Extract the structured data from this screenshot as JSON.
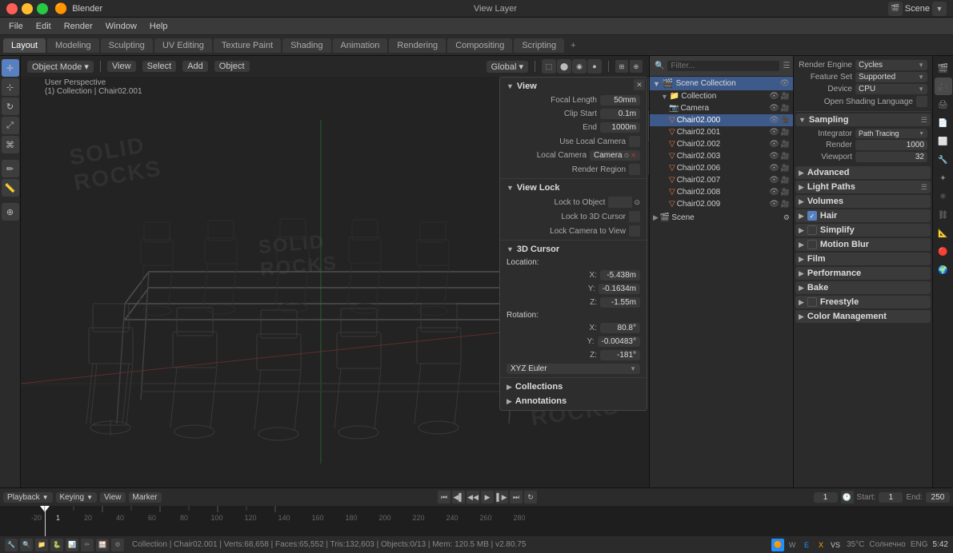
{
  "app": {
    "title": "Blender"
  },
  "titlebar": {
    "title": "Blender"
  },
  "menubar": {
    "items": [
      "File",
      "Edit",
      "Render",
      "Window",
      "Help"
    ]
  },
  "workspacetabs": {
    "tabs": [
      "Layout",
      "Modeling",
      "Sculpting",
      "UV Editing",
      "Texture Paint",
      "Shading",
      "Animation",
      "Rendering",
      "Compositing",
      "Scripting"
    ],
    "active": "Layout"
  },
  "viewport": {
    "mode": "Object Mode",
    "view": "User Perspective",
    "collection": "(1) Collection | Chair02.001",
    "global": "Global",
    "shading_mode": "Wireframe",
    "watermarks": [
      "SOLID",
      "ROCKS",
      "SOLID",
      "ROCKS",
      "SOLID",
      "ROCKS"
    ]
  },
  "view_panel": {
    "sections": {
      "view": {
        "title": "View",
        "focal_length": {
          "label": "Focal Length",
          "value": "50mm"
        },
        "clip_start": {
          "label": "Clip Start",
          "value": "0.1m"
        },
        "clip_end": {
          "label": "End",
          "value": "1000m"
        },
        "use_local_camera": {
          "label": "Use Local Camera",
          "checked": false
        },
        "local_camera": {
          "label": "Local Camera",
          "value": "Camera"
        },
        "render_region": {
          "label": "Render Region",
          "checked": false
        }
      },
      "view_lock": {
        "title": "View Lock",
        "lock_to_object": {
          "label": "Lock to Object",
          "value": ""
        },
        "lock_to_3d_cursor": {
          "label": "Lock to 3D Cursor",
          "checked": false
        },
        "lock_camera_to_view": {
          "label": "Lock Camera to View",
          "checked": false
        }
      },
      "cursor_3d": {
        "title": "3D Cursor",
        "location_label": "Location:",
        "x": {
          "label": "X:",
          "value": "-5.438m"
        },
        "y": {
          "label": "Y:",
          "value": "-0.1634m"
        },
        "z": {
          "label": "Z:",
          "value": "-1.55m"
        },
        "rotation_label": "Rotation:",
        "rx": {
          "label": "X:",
          "value": "80.8°"
        },
        "ry": {
          "label": "Y:",
          "value": "-0.00483°"
        },
        "rz": {
          "label": "Z:",
          "value": "-181°"
        },
        "rotation_mode": "XYZ Euler"
      },
      "collections": {
        "title": "Collections"
      },
      "annotations": {
        "title": "Annotations"
      }
    }
  },
  "outliner": {
    "title": "Scene Collection",
    "scene_label": "Scene",
    "items": [
      {
        "indent": 0,
        "icon": "📁",
        "label": "Collection",
        "has_arrow": true,
        "visible": true
      },
      {
        "indent": 1,
        "icon": "📷",
        "label": "Camera",
        "has_arrow": false,
        "visible": true
      },
      {
        "indent": 1,
        "icon": "🪑",
        "label": "Chair02.000",
        "has_arrow": false,
        "visible": true,
        "selected": true
      },
      {
        "indent": 1,
        "icon": "🪑",
        "label": "Chair02.001",
        "has_arrow": false,
        "visible": true
      },
      {
        "indent": 1,
        "icon": "🪑",
        "label": "Chair02.002",
        "has_arrow": false,
        "visible": true
      },
      {
        "indent": 1,
        "icon": "🪑",
        "label": "Chair02.003",
        "has_arrow": false,
        "visible": true
      },
      {
        "indent": 1,
        "icon": "🪑",
        "label": "Chair02.006",
        "has_arrow": false,
        "visible": true
      },
      {
        "indent": 1,
        "icon": "🪑",
        "label": "Chair02.007",
        "has_arrow": false,
        "visible": true
      },
      {
        "indent": 1,
        "icon": "🪑",
        "label": "Chair02.008",
        "has_arrow": false,
        "visible": true
      },
      {
        "indent": 1,
        "icon": "🪑",
        "label": "Chair02.009",
        "has_arrow": false,
        "visible": true
      }
    ]
  },
  "properties": {
    "active_tab": "render",
    "render_engine_label": "Render Engine",
    "render_engine_value": "Cycles",
    "feature_set_label": "Feature Set",
    "feature_set_value": "Supported",
    "device_label": "Device",
    "device_value": "CPU",
    "open_shading_label": "Open Shading Language",
    "sections": {
      "sampling": {
        "title": "Sampling",
        "integrator_label": "Integrator",
        "integrator_value": "Path Tracing",
        "render_label": "Render",
        "render_value": "1000",
        "viewport_label": "Viewport",
        "viewport_value": "32"
      },
      "advanced": {
        "title": "Advanced",
        "collapsed": true
      },
      "light_paths": {
        "title": "Light Paths",
        "collapsed": true
      },
      "volumes": {
        "title": "Volumes",
        "collapsed": true
      },
      "hair": {
        "title": "Hair",
        "checked": true,
        "collapsed": true
      },
      "simplify": {
        "title": "Simplify",
        "checked": false,
        "collapsed": true
      },
      "motion_blur": {
        "title": "Motion Blur",
        "checked": false,
        "collapsed": true
      },
      "film": {
        "title": "Film",
        "collapsed": true
      },
      "performance": {
        "title": "Performance",
        "collapsed": true
      },
      "bake": {
        "title": "Bake",
        "collapsed": true
      },
      "freestyle": {
        "title": "Freestyle",
        "checked": false,
        "collapsed": true
      },
      "color_management": {
        "title": "Color Management",
        "collapsed": true
      }
    }
  },
  "timeline": {
    "mode_label": "Playback",
    "keying_label": "Keying",
    "view_label": "View",
    "marker_label": "Marker",
    "current_frame": "1",
    "start_label": "Start:",
    "start_value": "1",
    "end_label": "End:",
    "end_value": "250",
    "numbers": [
      "-20",
      "1",
      "20",
      "40",
      "60",
      "80",
      "100",
      "120",
      "140",
      "160",
      "180",
      "200",
      "220",
      "240",
      "260",
      "280"
    ]
  },
  "statusbar": {
    "collection": "Collection | Chair02.001",
    "verts": "Verts:68,658",
    "faces": "Faces:65,552",
    "tris": "Tris:132,603",
    "objects": "Objects:0/13",
    "mem": "Mem: 120.5 MB",
    "version": "v2.80.75",
    "temp": "35°C",
    "weather": "Солнечно",
    "time": "5:42",
    "lang": "ENG"
  },
  "icons": {
    "arrow_right": "▶",
    "arrow_down": "▼",
    "close": "✕",
    "eye": "👁",
    "camera": "📷",
    "collection": "📁",
    "scene": "🎬",
    "render": "🎥",
    "check": "✓",
    "plus": "+",
    "minus": "−",
    "dot": "•"
  }
}
